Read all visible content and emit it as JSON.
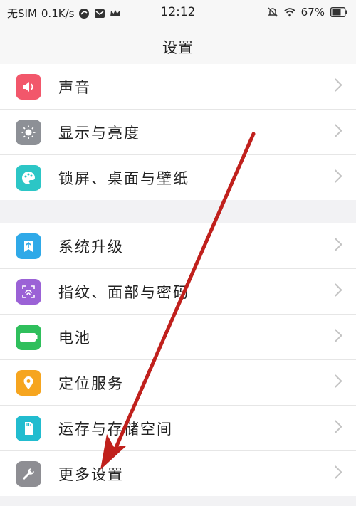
{
  "status_bar": {
    "carrier": "无SIM",
    "speed": "0.1K/s",
    "time": "12:12",
    "battery": "67%"
  },
  "nav": {
    "title": "设置"
  },
  "group1": [
    {
      "label": "声音",
      "icon": "speaker-icon",
      "color": "#f2576b"
    },
    {
      "label": "显示与亮度",
      "icon": "brightness-icon",
      "color": "#8d9096"
    },
    {
      "label": "锁屏、桌面与壁纸",
      "icon": "palette-icon",
      "color": "#2cc6c6"
    }
  ],
  "group2": [
    {
      "label": "系统升级",
      "icon": "system-update-icon",
      "color": "#2fa9e8"
    },
    {
      "label": "指纹、面部与密码",
      "icon": "fingerprint-icon",
      "color": "#9b62d6"
    },
    {
      "label": "电池",
      "icon": "battery-icon",
      "color": "#2fbf5c"
    },
    {
      "label": "定位服务",
      "icon": "location-icon",
      "color": "#f6a51f"
    },
    {
      "label": "运存与存储空间",
      "icon": "storage-icon",
      "color": "#22bccf"
    },
    {
      "label": "更多设置",
      "icon": "wrench-icon",
      "color": "#8e8e93"
    }
  ],
  "annotation": {
    "color": "#c0201c"
  }
}
